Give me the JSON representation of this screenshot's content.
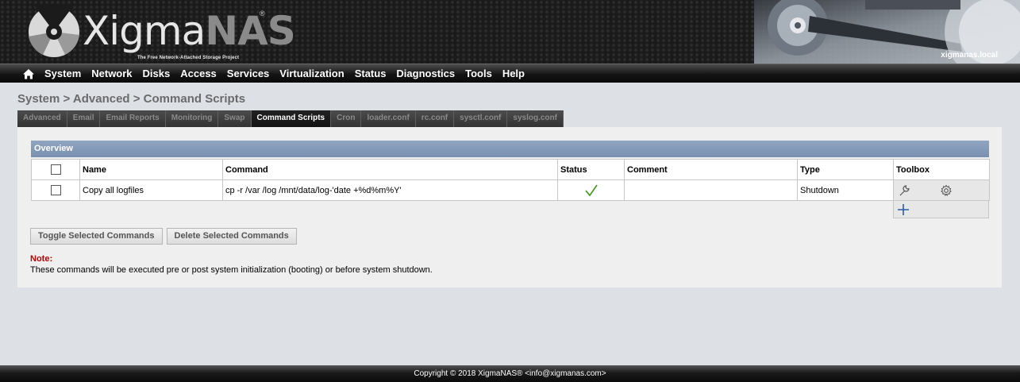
{
  "header": {
    "logo_main": "Xigma",
    "logo_accent": "NAS",
    "logo_reg": "®",
    "tagline": "The Free Network-Attached Storage Project",
    "hostname": "xigmanas.local"
  },
  "nav": {
    "home_icon": "home-icon",
    "items": [
      "System",
      "Network",
      "Disks",
      "Access",
      "Services",
      "Virtualization",
      "Status",
      "Diagnostics",
      "Tools",
      "Help"
    ]
  },
  "breadcrumb": "System > Advanced > Command Scripts",
  "tabs": [
    {
      "label": "Advanced",
      "active": false
    },
    {
      "label": "Email",
      "active": false
    },
    {
      "label": "Email Reports",
      "active": false
    },
    {
      "label": "Monitoring",
      "active": false
    },
    {
      "label": "Swap",
      "active": false
    },
    {
      "label": "Command Scripts",
      "active": true
    },
    {
      "label": "Cron",
      "active": false
    },
    {
      "label": "loader.conf",
      "active": false
    },
    {
      "label": "rc.conf",
      "active": false
    },
    {
      "label": "sysctl.conf",
      "active": false
    },
    {
      "label": "syslog.conf",
      "active": false
    }
  ],
  "overview": {
    "title": "Overview",
    "columns": [
      "Name",
      "Command",
      "Status",
      "Comment",
      "Type",
      "Toolbox"
    ],
    "rows": [
      {
        "name": "Copy all logfiles",
        "command": "cp -r /var /log /mnt/data/log-'date +%d%m%Y'",
        "status": "enabled",
        "comment": "",
        "type": "Shutdown"
      }
    ]
  },
  "buttons": {
    "toggle": "Toggle Selected Commands",
    "delete": "Delete Selected Commands"
  },
  "note": {
    "label": "Note:",
    "text": "These commands will be executed pre or post system initialization (booting) or before system shutdown."
  },
  "footer": "Copyright © 2018 XigmaNAS® <info@xigmanas.com>",
  "colors": {
    "accent_blue": "#2a5caa",
    "status_green": "#3a9a1a",
    "note_red": "#c00000"
  }
}
